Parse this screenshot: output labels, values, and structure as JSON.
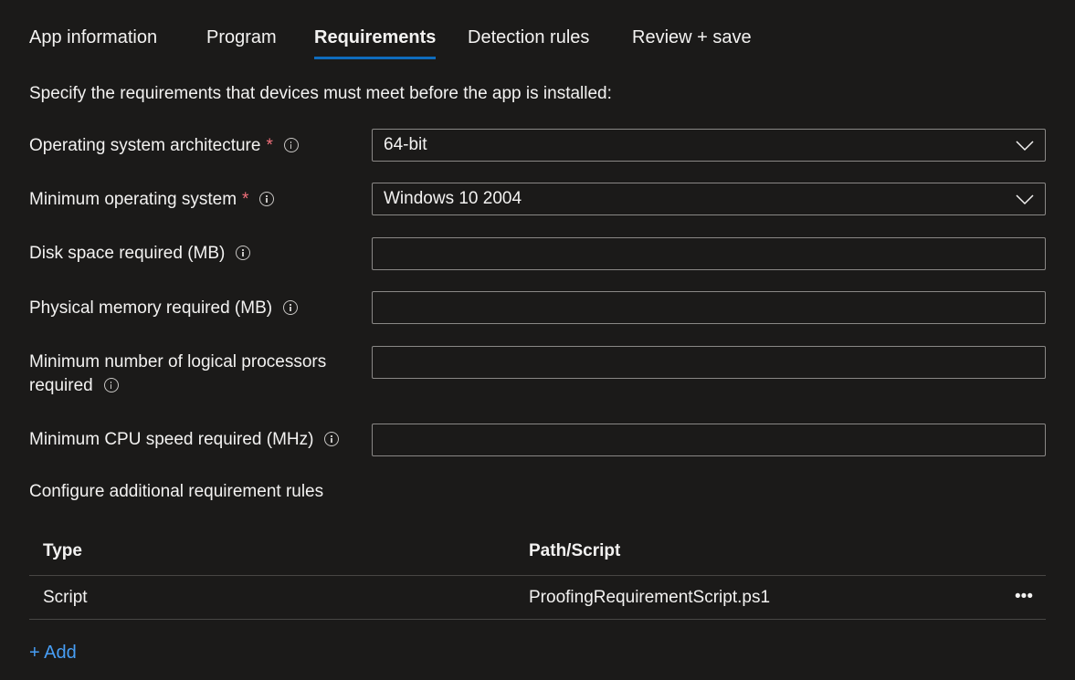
{
  "tabs": [
    {
      "label": "App information",
      "active": false
    },
    {
      "label": "Program",
      "active": false
    },
    {
      "label": "Requirements",
      "active": true
    },
    {
      "label": "Detection rules",
      "active": false
    },
    {
      "label": "Review + save",
      "active": false
    }
  ],
  "intro": "Specify the requirements that devices must meet before the app is installed:",
  "fields": {
    "os_architecture": {
      "label": "Operating system architecture",
      "required": true,
      "value": "64-bit",
      "type": "dropdown"
    },
    "min_os": {
      "label": "Minimum operating system",
      "required": true,
      "value": "Windows 10 2004",
      "type": "dropdown"
    },
    "disk_space": {
      "label": "Disk space required (MB)",
      "value": ""
    },
    "physical_memory": {
      "label": "Physical memory required (MB)",
      "value": ""
    },
    "logical_processors": {
      "label_line1": "Minimum number of logical processors",
      "label_line2": "required",
      "value": ""
    },
    "cpu_speed": {
      "label": "Minimum CPU speed required (MHz)",
      "value": ""
    }
  },
  "required_marker": "*",
  "additional_rules": {
    "title": "Configure additional requirement rules",
    "columns": [
      "Type",
      "Path/Script"
    ],
    "rows": [
      {
        "type": "Script",
        "path": "ProofingRequirementScript.ps1",
        "menu": "•••"
      }
    ],
    "add_label": "+ Add"
  },
  "colors": {
    "accent": "#0f6cbd",
    "link": "#479ef5",
    "required": "#f1707b",
    "background": "#1b1a19"
  }
}
